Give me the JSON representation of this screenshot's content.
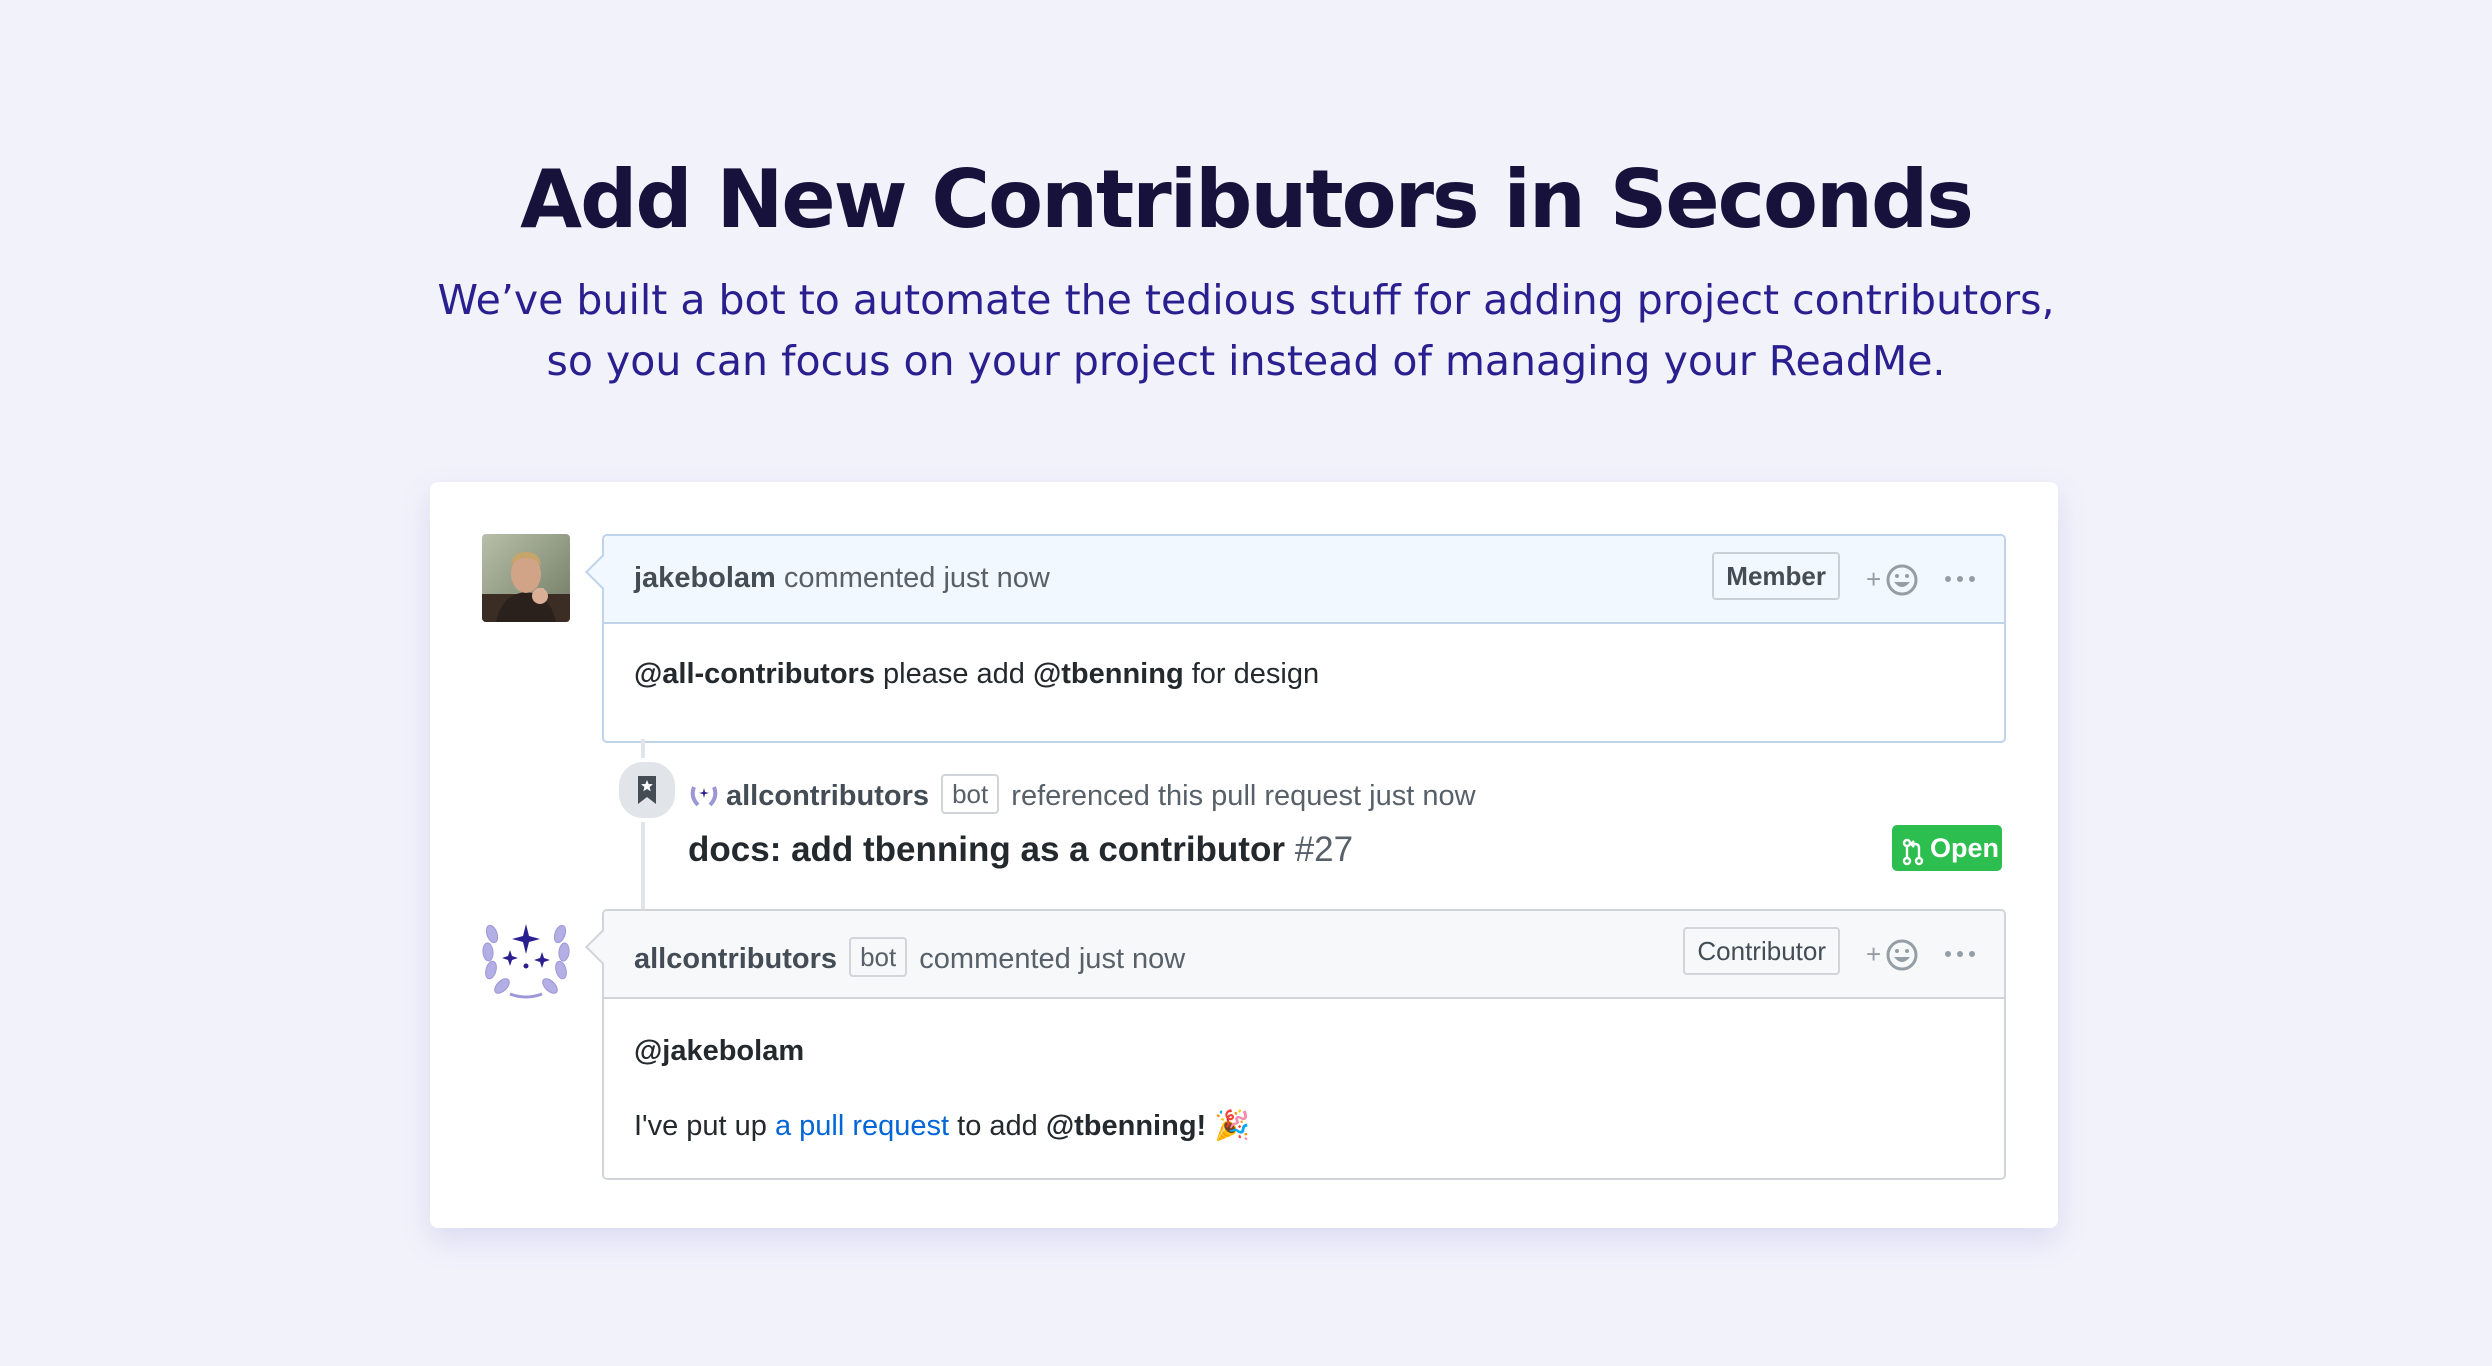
{
  "hero": {
    "title": "Add New Contributors in Seconds",
    "subtitle_line1": "We’ve built a bot to automate the tedious stuff for adding project contributors,",
    "subtitle_line2": "so you can focus on your project instead of managing your ReadMe."
  },
  "comment1": {
    "author": "jakebolam",
    "meta": "commented just now",
    "role": "Member",
    "body": {
      "mention1": "@all-contributors",
      "text1": " please add ",
      "mention2": "@tbenning",
      "text2": " for design"
    }
  },
  "event": {
    "actor": "allcontributors",
    "bot_label": "bot",
    "action": "referenced this pull request just now",
    "pr_title": "docs: add tbenning as a contributor",
    "pr_number": "#27",
    "state": "Open"
  },
  "comment2": {
    "author": "allcontributors",
    "bot_label": "bot",
    "meta": "commented just now",
    "role": "Contributor",
    "body": {
      "line1": "@jakebolam",
      "text1": "I've put up ",
      "link": "a pull request",
      "text2": " to add ",
      "mention": "@tbenning!",
      "emoji": "🎉"
    }
  },
  "icons": {
    "reaction": "smiley-add-icon",
    "more": "kebab-horizontal-icon",
    "bookmark": "bookmark-icon",
    "pull_request": "git-pull-request-icon",
    "bot_logo": "laurel-sparkle-icon"
  },
  "colors": {
    "background": "#f2f2fb",
    "title": "#16123b",
    "subtitle": "#2a1f8f",
    "open_green": "#2cbe4e",
    "link_blue": "#0366d6"
  }
}
